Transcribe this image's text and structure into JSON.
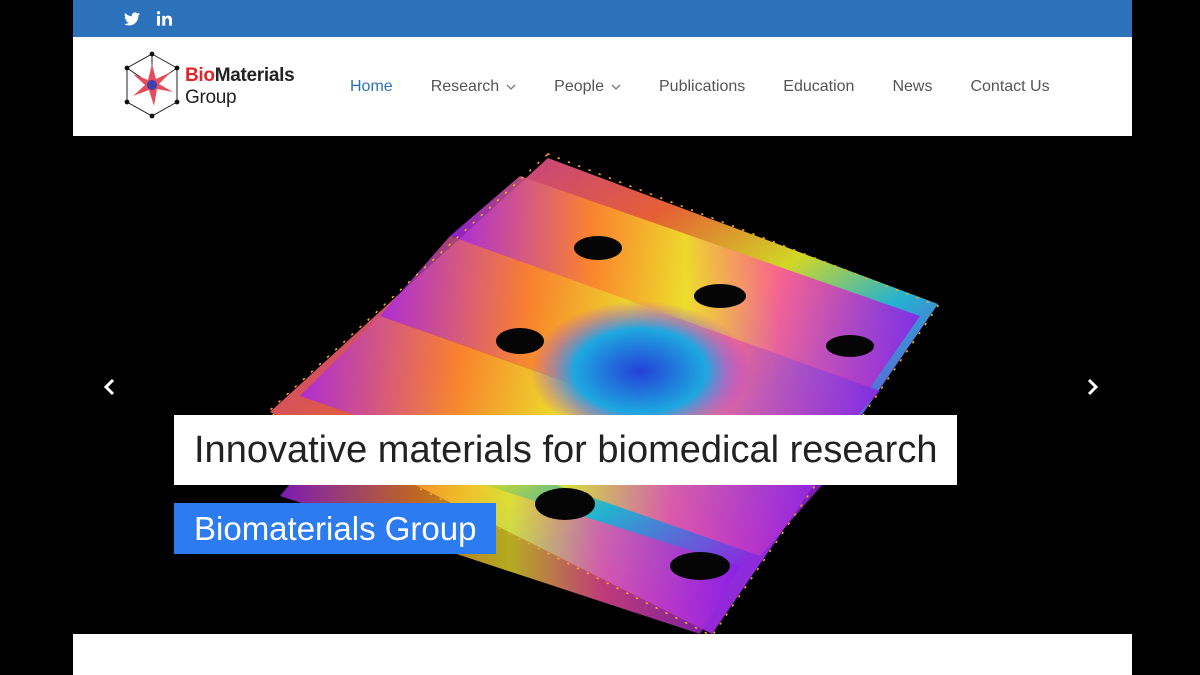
{
  "social": {
    "icons": [
      "twitter-icon",
      "linkedin-icon"
    ]
  },
  "brand": {
    "part1": "Bio",
    "part2": "Materials",
    "line2": "Group",
    "accent_color": "#e0252b"
  },
  "nav": {
    "items": [
      {
        "label": "Home",
        "active": true
      },
      {
        "label": "Research",
        "dropdown": true
      },
      {
        "label": "People",
        "dropdown": true
      },
      {
        "label": "Publications"
      },
      {
        "label": "Education"
      },
      {
        "label": "News"
      },
      {
        "label": "Contact Us"
      }
    ]
  },
  "hero": {
    "title": "Innovative materials for biomedical research",
    "subtitle": "Biomaterials Group",
    "prev_icon": "chevron-left-icon",
    "next_icon": "chevron-right-icon"
  },
  "colors": {
    "topbar": "#2b72bb",
    "active_link": "#2b72bb",
    "subtitle_bg": "#2d7bf0"
  }
}
